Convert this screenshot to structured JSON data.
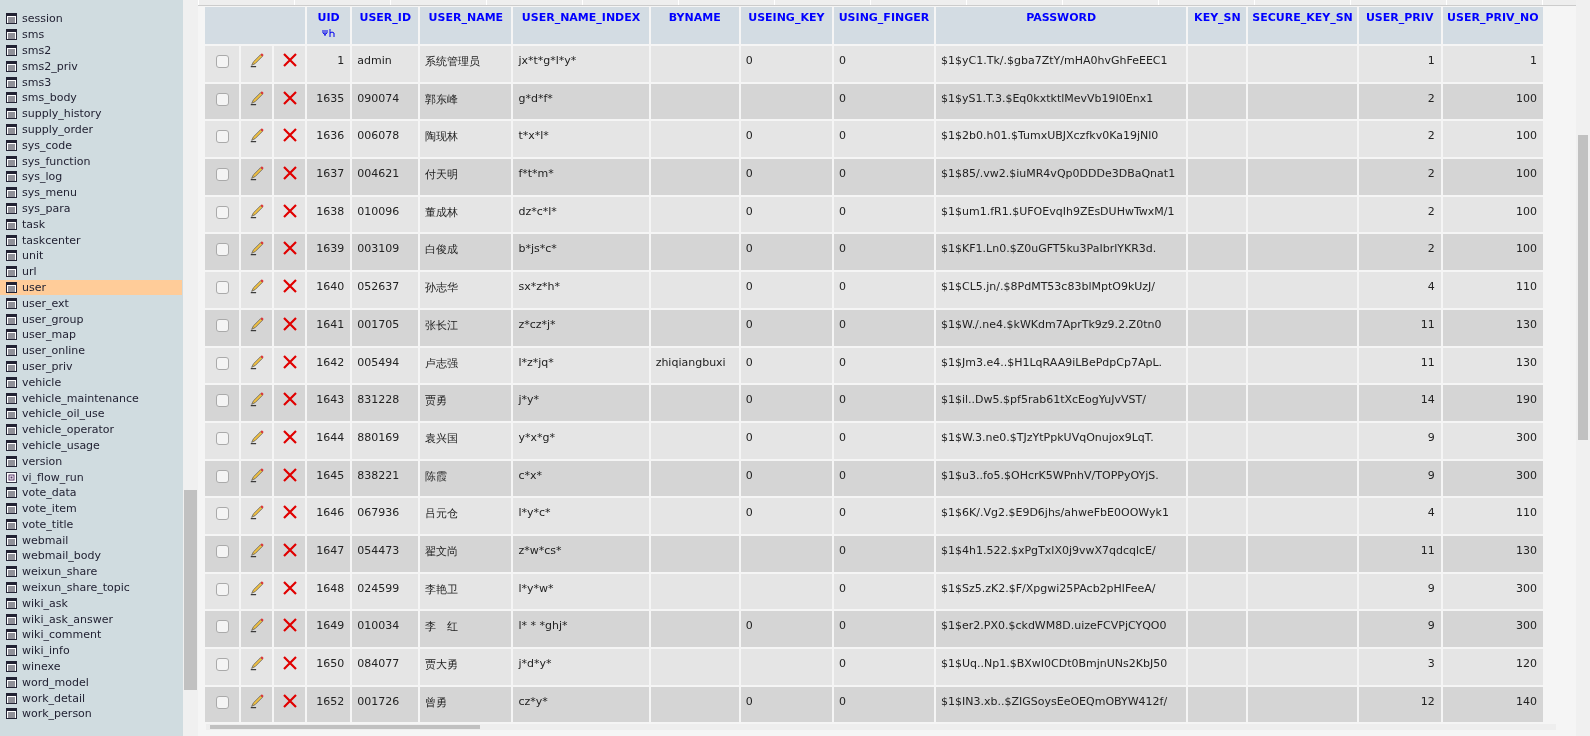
{
  "sidebar": {
    "items": [
      {
        "label": "session",
        "kind": "table",
        "selected": false
      },
      {
        "label": "sms",
        "kind": "table",
        "selected": false
      },
      {
        "label": "sms2",
        "kind": "table",
        "selected": false
      },
      {
        "label": "sms2_priv",
        "kind": "table",
        "selected": false
      },
      {
        "label": "sms3",
        "kind": "table",
        "selected": false
      },
      {
        "label": "sms_body",
        "kind": "table",
        "selected": false
      },
      {
        "label": "supply_history",
        "kind": "table",
        "selected": false
      },
      {
        "label": "supply_order",
        "kind": "table",
        "selected": false
      },
      {
        "label": "sys_code",
        "kind": "table",
        "selected": false
      },
      {
        "label": "sys_function",
        "kind": "table",
        "selected": false
      },
      {
        "label": "sys_log",
        "kind": "table",
        "selected": false
      },
      {
        "label": "sys_menu",
        "kind": "table",
        "selected": false
      },
      {
        "label": "sys_para",
        "kind": "table",
        "selected": false
      },
      {
        "label": "task",
        "kind": "table",
        "selected": false
      },
      {
        "label": "taskcenter",
        "kind": "table",
        "selected": false
      },
      {
        "label": "unit",
        "kind": "table",
        "selected": false
      },
      {
        "label": "url",
        "kind": "table",
        "selected": false
      },
      {
        "label": "user",
        "kind": "table",
        "selected": true
      },
      {
        "label": "user_ext",
        "kind": "table",
        "selected": false
      },
      {
        "label": "user_group",
        "kind": "table",
        "selected": false
      },
      {
        "label": "user_map",
        "kind": "table",
        "selected": false
      },
      {
        "label": "user_online",
        "kind": "table",
        "selected": false
      },
      {
        "label": "user_priv",
        "kind": "table",
        "selected": false
      },
      {
        "label": "vehicle",
        "kind": "table",
        "selected": false
      },
      {
        "label": "vehicle_maintenance",
        "kind": "table",
        "selected": false
      },
      {
        "label": "vehicle_oil_use",
        "kind": "table",
        "selected": false
      },
      {
        "label": "vehicle_operator",
        "kind": "table",
        "selected": false
      },
      {
        "label": "vehicle_usage",
        "kind": "table",
        "selected": false
      },
      {
        "label": "version",
        "kind": "table",
        "selected": false
      },
      {
        "label": "vi_flow_run",
        "kind": "view",
        "selected": false
      },
      {
        "label": "vote_data",
        "kind": "table",
        "selected": false
      },
      {
        "label": "vote_item",
        "kind": "table",
        "selected": false
      },
      {
        "label": "vote_title",
        "kind": "table",
        "selected": false
      },
      {
        "label": "webmail",
        "kind": "table",
        "selected": false
      },
      {
        "label": "webmail_body",
        "kind": "table",
        "selected": false
      },
      {
        "label": "weixun_share",
        "kind": "table",
        "selected": false
      },
      {
        "label": "weixun_share_topic",
        "kind": "table",
        "selected": false
      },
      {
        "label": "wiki_ask",
        "kind": "table",
        "selected": false
      },
      {
        "label": "wiki_ask_answer",
        "kind": "table",
        "selected": false
      },
      {
        "label": "wiki_comment",
        "kind": "table",
        "selected": false
      },
      {
        "label": "wiki_info",
        "kind": "table",
        "selected": false
      },
      {
        "label": "winexe",
        "kind": "table",
        "selected": false
      },
      {
        "label": "word_model",
        "kind": "table",
        "selected": false
      },
      {
        "label": "work_detail",
        "kind": "table",
        "selected": false
      },
      {
        "label": "work_person",
        "kind": "table",
        "selected": false
      }
    ]
  },
  "table": {
    "columns": [
      {
        "label": "UID",
        "kind": "numeric",
        "sorted": true
      },
      {
        "label": "USER_ID",
        "kind": "text",
        "sorted": false
      },
      {
        "label": "USER_NAME",
        "kind": "text",
        "sorted": false
      },
      {
        "label": "USER_NAME_INDEX",
        "kind": "text",
        "sorted": false
      },
      {
        "label": "BYNAME",
        "kind": "text",
        "sorted": false
      },
      {
        "label": "USEING_KEY",
        "kind": "text",
        "sorted": false
      },
      {
        "label": "USING_FINGER",
        "kind": "text",
        "sorted": false
      },
      {
        "label": "PASSWORD",
        "kind": "text",
        "sorted": false
      },
      {
        "label": "KEY_SN",
        "kind": "text",
        "sorted": false
      },
      {
        "label": "SECURE_KEY_SN",
        "kind": "text",
        "sorted": false
      },
      {
        "label": "USER_PRIV",
        "kind": "numeric",
        "sorted": false
      },
      {
        "label": "USER_PRIV_NO",
        "kind": "numeric",
        "sorted": false
      }
    ],
    "rows": [
      {
        "checked": false,
        "cells": [
          "1",
          "admin",
          "系统管理员",
          "jx*t*g*l*y*",
          null,
          "0",
          "0",
          "$1$yC1.Tk/.$gba7ZtY/mHA0hvGhFeEEC1",
          null,
          null,
          "1",
          "1"
        ]
      },
      {
        "checked": false,
        "cells": [
          "1635",
          "090074",
          "郭东峰",
          "g*d*f*",
          null,
          null,
          "0",
          "$1$yS1.T.3.$Eq0kxtktlMevVb19I0Enx1",
          null,
          null,
          "2",
          "100"
        ]
      },
      {
        "checked": false,
        "cells": [
          "1636",
          "006078",
          "陶现林",
          "t*x*l*",
          null,
          "0",
          "0",
          "$1$2b0.h01.$TumxUBJXczfkv0Ka19jNl0",
          null,
          null,
          "2",
          "100"
        ]
      },
      {
        "checked": false,
        "cells": [
          "1637",
          "004621",
          "付天明",
          "f*t*m*",
          null,
          "0",
          "0",
          "$1$85/.vw2.$iuMR4vQp0DDDe3DBaQnat1",
          null,
          null,
          "2",
          "100"
        ]
      },
      {
        "checked": false,
        "cells": [
          "1638",
          "010096",
          "董成林",
          "dz*c*l*",
          null,
          "0",
          "0",
          "$1$um1.fR1.$UFOEvqIh9ZEsDUHwTwxM/1",
          null,
          null,
          "2",
          "100"
        ]
      },
      {
        "checked": false,
        "cells": [
          "1639",
          "003109",
          "白俊成",
          "b*js*c*",
          null,
          "0",
          "0",
          "$1$KF1.Ln0.$Z0uGFT5ku3PaIbrlYKR3d.",
          null,
          null,
          "2",
          "100"
        ]
      },
      {
        "checked": false,
        "cells": [
          "1640",
          "052637",
          "孙志华",
          "sx*z*h*",
          null,
          "0",
          "0",
          "$1$CL5.jn/.$8PdMT53c83blMptO9kUzJ/",
          null,
          null,
          "4",
          "110"
        ]
      },
      {
        "checked": false,
        "cells": [
          "1641",
          "001705",
          "张长江",
          "z*cz*j*",
          null,
          "0",
          "0",
          "$1$W./.ne4.$kWKdm7AprTk9z9.2.Z0tn0",
          null,
          null,
          "11",
          "130"
        ]
      },
      {
        "checked": false,
        "cells": [
          "1642",
          "005494",
          "卢志强",
          "l*z*jq*",
          "zhiqiangbuxi",
          "0",
          "0",
          "$1$Jm3.e4..$H1LqRAA9iLBePdpCp7ApL.",
          null,
          null,
          "11",
          "130"
        ]
      },
      {
        "checked": false,
        "cells": [
          "1643",
          "831228",
          "贾勇",
          "j*y*",
          null,
          "0",
          "0",
          "$1$il..Dw5.$pf5rab61tXcEogYuJvVST/",
          null,
          null,
          "14",
          "190"
        ]
      },
      {
        "checked": false,
        "cells": [
          "1644",
          "880169",
          "袁兴国",
          "y*x*g*",
          null,
          "0",
          "0",
          "$1$W.3.ne0.$TJzYtPpkUVqOnujox9LqT.",
          null,
          null,
          "9",
          "300"
        ]
      },
      {
        "checked": false,
        "cells": [
          "1645",
          "838221",
          "陈霞",
          "c*x*",
          null,
          "0",
          "0",
          "$1$u3..fo5.$OHcrK5WPnhV/TOPPyOYjS.",
          null,
          null,
          "9",
          "300"
        ]
      },
      {
        "checked": false,
        "cells": [
          "1646",
          "067936",
          "吕元仓",
          "l*y*c*",
          null,
          "0",
          "0",
          "$1$6K/.Vg2.$E9D6jhs/ahweFbE0OOWyk1",
          null,
          null,
          "4",
          "110"
        ]
      },
      {
        "checked": false,
        "cells": [
          "1647",
          "054473",
          "翟文尚",
          "z*w*cs*",
          null,
          null,
          "0",
          "$1$4h1.522.$xPgTxlX0j9vwX7qdcqlcE/",
          null,
          null,
          "11",
          "130"
        ]
      },
      {
        "checked": false,
        "cells": [
          "1648",
          "024599",
          "李艳卫",
          "l*y*w*",
          null,
          null,
          "0",
          "$1$Sz5.zK2.$F/Xpgwi25PAcb2pHlFeeA/",
          null,
          null,
          "9",
          "300"
        ]
      },
      {
        "checked": false,
        "cells": [
          "1649",
          "010034",
          "李　红",
          "l* * *ghj*",
          null,
          "0",
          "0",
          "$1$er2.PX0.$ckdWM8D.uizeFCVPjCYQO0",
          null,
          null,
          "9",
          "300"
        ]
      },
      {
        "checked": false,
        "cells": [
          "1650",
          "084077",
          "贾大勇",
          "j*d*y*",
          null,
          null,
          "0",
          "$1$Uq..Np1.$BXwI0CDt0BmjnUNs2KbJ50",
          null,
          null,
          "3",
          "120"
        ]
      },
      {
        "checked": false,
        "cells": [
          "1652",
          "001726",
          "曾勇",
          "cz*y*",
          null,
          "0",
          "0",
          "$1$IN3.xb..$ZIGSoysEeOEQmOBYW412f/",
          null,
          null,
          "12",
          "140"
        ]
      }
    ]
  }
}
